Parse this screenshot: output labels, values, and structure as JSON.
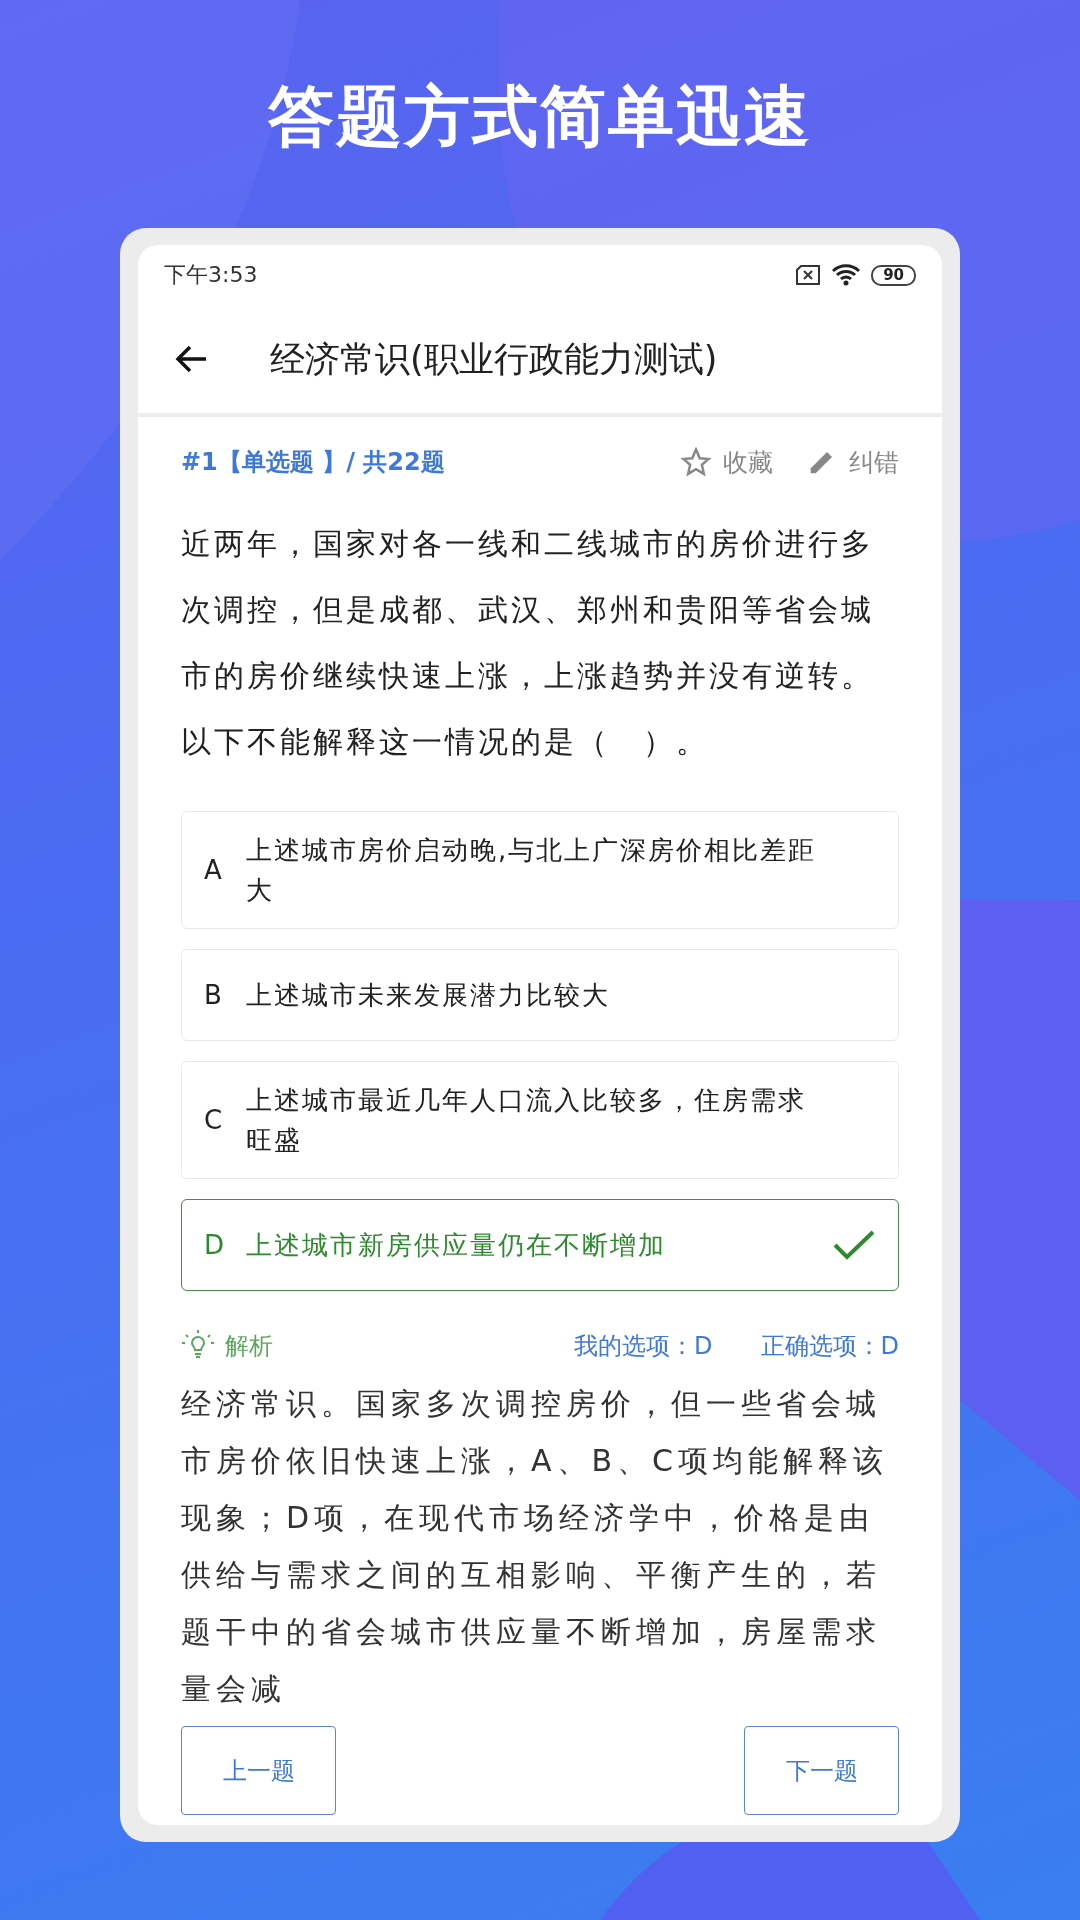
{
  "headline": "答题方式简单迅速",
  "status_bar": {
    "time": "下午3:53",
    "battery": "90"
  },
  "header": {
    "title": "经济常识(职业行政能力测试)"
  },
  "question": {
    "meta": "#1【单选题 】/ 共22题",
    "actions": [
      {
        "kind": "star",
        "label": "收藏"
      },
      {
        "kind": "pencil",
        "label": "纠错"
      }
    ],
    "text": " 近两年，国家对各一线和二线城市的房价进行多次调控，但是成都、武汉、郑州和贵阳等省会城市的房价继续快速上涨，上涨趋势并没有逆转。以下不能解释这一情况的是（　）。"
  },
  "options": [
    {
      "letter": "A",
      "text": "上述城市房价启动晚,与北上广深房价相比差距大",
      "correct": false
    },
    {
      "letter": "B",
      "text": "上述城市未来发展潜力比较大",
      "correct": false
    },
    {
      "letter": "C",
      "text": "上述城市最近几年人口流入比较多，住房需求旺盛",
      "correct": false
    },
    {
      "letter": "D",
      "text": "上述城市新房供应量仍在不断增加",
      "correct": true
    }
  ],
  "analysis": {
    "label": "解析",
    "my_choice": "我的选项：D",
    "correct_choice": "正确选项：D",
    "text": "经济常识。国家多次调控房价，但一些省会城市房价依旧快速上涨，A、B、C项均能解释该现象；D项，在现代市场经济学中，价格是由供给与需求之间的互相影响、平衡产生的，若题干中的省会城市供应量不断增加，房屋需求量会减"
  },
  "nav": {
    "prev": "上一题",
    "next": "下一题"
  }
}
